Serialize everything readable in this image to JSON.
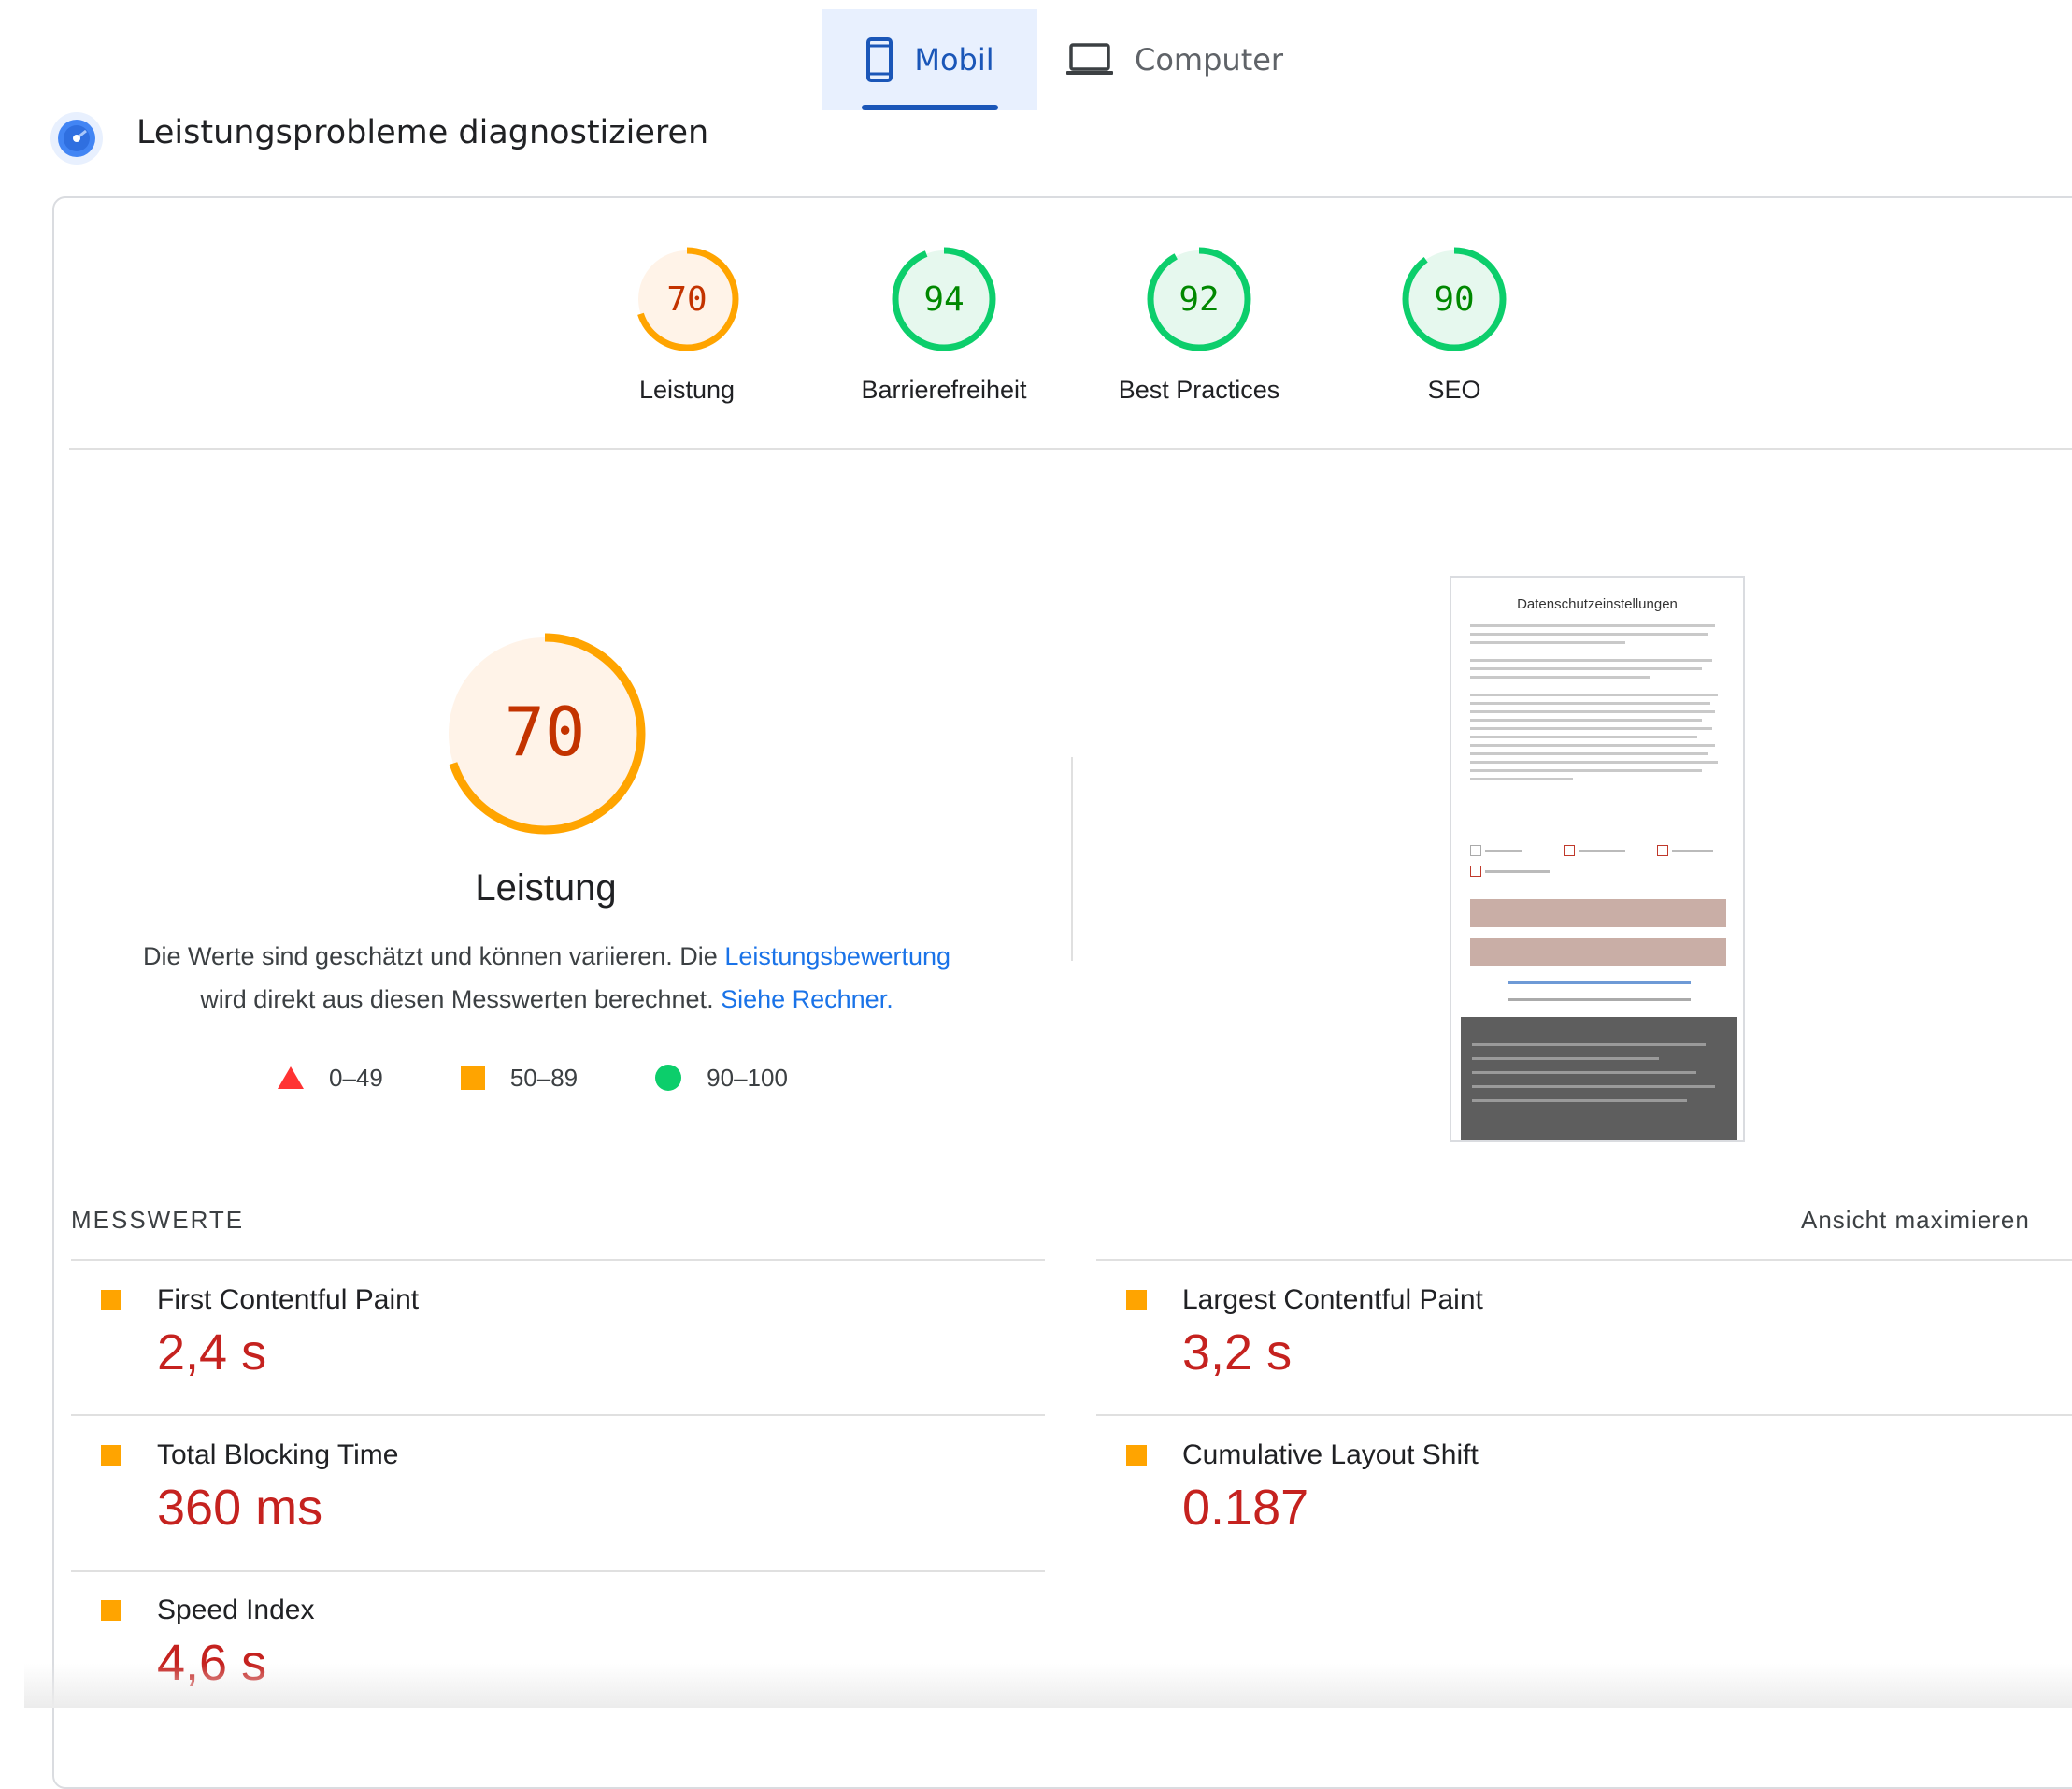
{
  "tabs": [
    {
      "label": "Mobil",
      "active": true,
      "icon": "phone-icon"
    },
    {
      "label": "Computer",
      "active": false,
      "icon": "laptop-icon"
    }
  ],
  "header": {
    "title": "Leistungsprobleme diagnostizieren",
    "icon": "diagnostics-icon"
  },
  "scores": [
    {
      "value": "70",
      "label": "Leistung",
      "status": "average"
    },
    {
      "value": "94",
      "label": "Barrierefreiheit",
      "status": "pass"
    },
    {
      "value": "92",
      "label": "Best Practices",
      "status": "pass"
    },
    {
      "value": "90",
      "label": "SEO",
      "status": "pass"
    }
  ],
  "performance": {
    "score": "70",
    "title": "Leistung",
    "desc_part1": "Die Werte sind geschätzt und können variieren. Die ",
    "desc_link1": "Leistungsbewertung",
    "desc_part2": "wird direkt aus diesen Messwerten berechnet. ",
    "desc_link2": "Siehe Rechner."
  },
  "legend": [
    {
      "range": "0–49",
      "shape": "triangle",
      "color": "#ff3333"
    },
    {
      "range": "50–89",
      "shape": "square",
      "color": "#ffa400"
    },
    {
      "range": "90–100",
      "shape": "circle",
      "color": "#0cce6b"
    }
  ],
  "colors": {
    "average": "#ffa400",
    "average_text": "#c33300",
    "pass": "#0cce6b",
    "pass_text": "#008800",
    "link": "#1a73e8"
  },
  "screenshot": {
    "title": "Datenschutzeinstellungen"
  },
  "metrics": {
    "heading": "MESSWERTE",
    "expand_label": "Ansicht maximieren",
    "items": [
      {
        "label": "First Contentful Paint",
        "value": "2,4 s"
      },
      {
        "label": "Largest Contentful Paint",
        "value": "3,2 s"
      },
      {
        "label": "Total Blocking Time",
        "value": "360 ms"
      },
      {
        "label": "Cumulative Layout Shift",
        "value": "0.187"
      },
      {
        "label": "Speed Index",
        "value": "4,6 s"
      }
    ]
  }
}
